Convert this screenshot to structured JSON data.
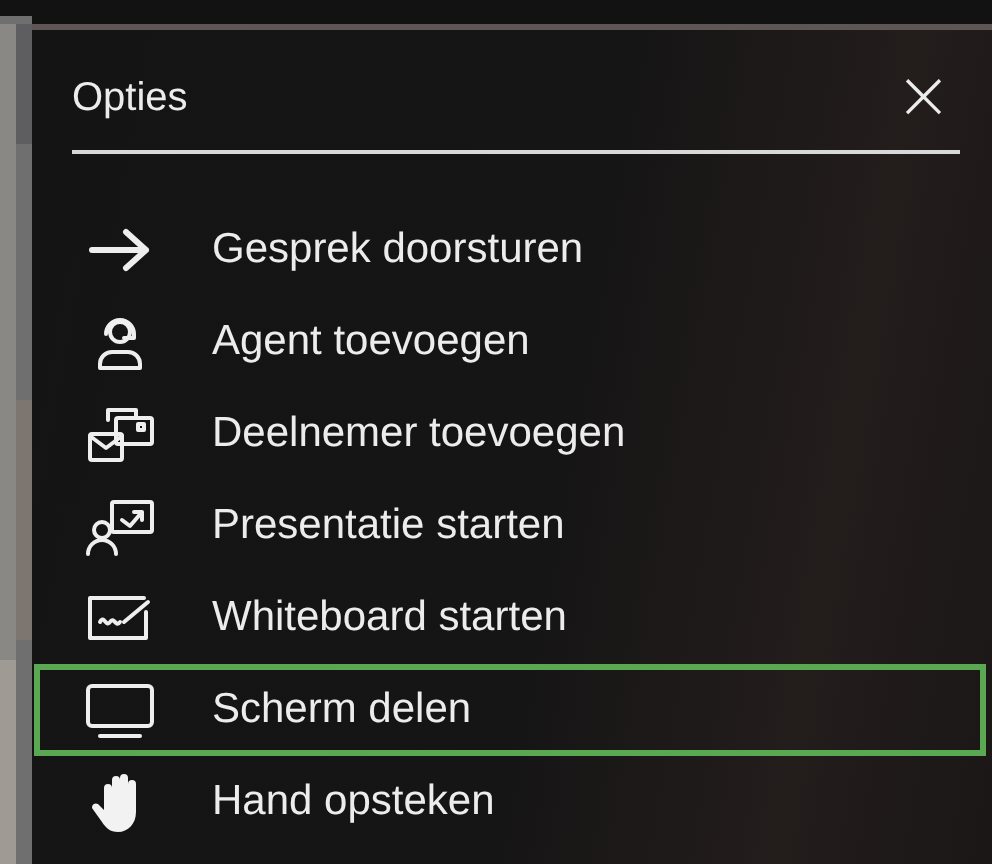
{
  "title": "Opties",
  "close": "×",
  "items": [
    {
      "kind": "arrow",
      "label": "Gesprek doorsturen",
      "selected": false
    },
    {
      "kind": "agent",
      "label": "Agent toevoegen",
      "selected": false
    },
    {
      "kind": "participant",
      "label": "Deelnemer toevoegen",
      "selected": false
    },
    {
      "kind": "presentation",
      "label": "Presentatie starten",
      "selected": false
    },
    {
      "kind": "whiteboard",
      "label": "Whiteboard starten",
      "selected": false
    },
    {
      "kind": "screen",
      "label": "Scherm delen",
      "selected": true
    },
    {
      "kind": "hand",
      "label": "Hand opsteken",
      "selected": false
    }
  ]
}
